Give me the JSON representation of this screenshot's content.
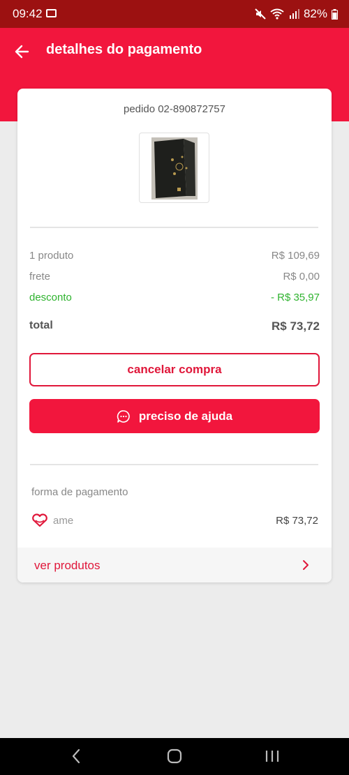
{
  "status_bar": {
    "time": "09:42",
    "battery": "82%"
  },
  "header": {
    "title": "detalhes do pagamento"
  },
  "order": {
    "id_label": "pedido 02-890872757"
  },
  "summary": {
    "products_label": "1 produto",
    "products_value": "R$ 109,69",
    "shipping_label": "frete",
    "shipping_value": "R$ 0,00",
    "discount_label": "desconto",
    "discount_value": "- R$ 35,97",
    "total_label": "total",
    "total_value": "R$ 73,72"
  },
  "actions": {
    "cancel_label": "cancelar compra",
    "help_label": "preciso de ajuda"
  },
  "payment": {
    "section_label": "forma de pagamento",
    "method": "ame",
    "amount": "R$ 73,72"
  },
  "footer": {
    "see_products_label": "ver produtos"
  },
  "colors": {
    "brand": "#f2163d",
    "status_bar": "#9c1111",
    "discount": "#2fb32f"
  },
  "icons": [
    "back-arrow-icon",
    "chat-bubble-icon",
    "heart-icon",
    "chevron-right-icon"
  ]
}
